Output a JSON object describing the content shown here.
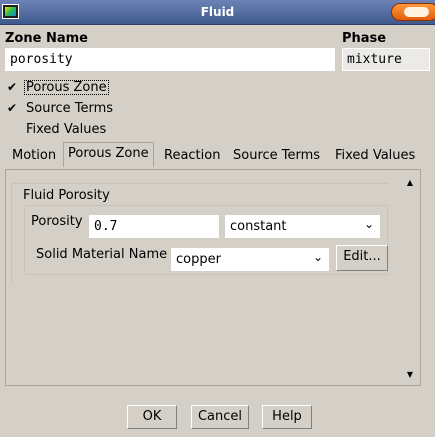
{
  "window": {
    "title": "Fluid"
  },
  "zone_name": {
    "label": "Zone Name",
    "value": "porosity"
  },
  "phase": {
    "label": "Phase",
    "value": "mixture"
  },
  "options": [
    {
      "label": "Porous Zone",
      "checked": true
    },
    {
      "label": "Source Terms",
      "checked": true
    },
    {
      "label": "Fixed Values",
      "checked": false
    }
  ],
  "tabs": [
    "Motion",
    "Porous Zone",
    "Reaction",
    "Source Terms",
    "Fixed Values"
  ],
  "active_tab": "Porous Zone",
  "fluid_porosity": {
    "heading": "Fluid Porosity",
    "porosity_label": "Porosity",
    "porosity_value": "0.7",
    "porosity_method": "constant",
    "material_label": "Solid Material Name",
    "material_value": "copper",
    "edit_label": "Edit..."
  },
  "checkmark": "✔",
  "buttons": {
    "ok": "OK",
    "cancel": "Cancel",
    "help": "Help"
  }
}
